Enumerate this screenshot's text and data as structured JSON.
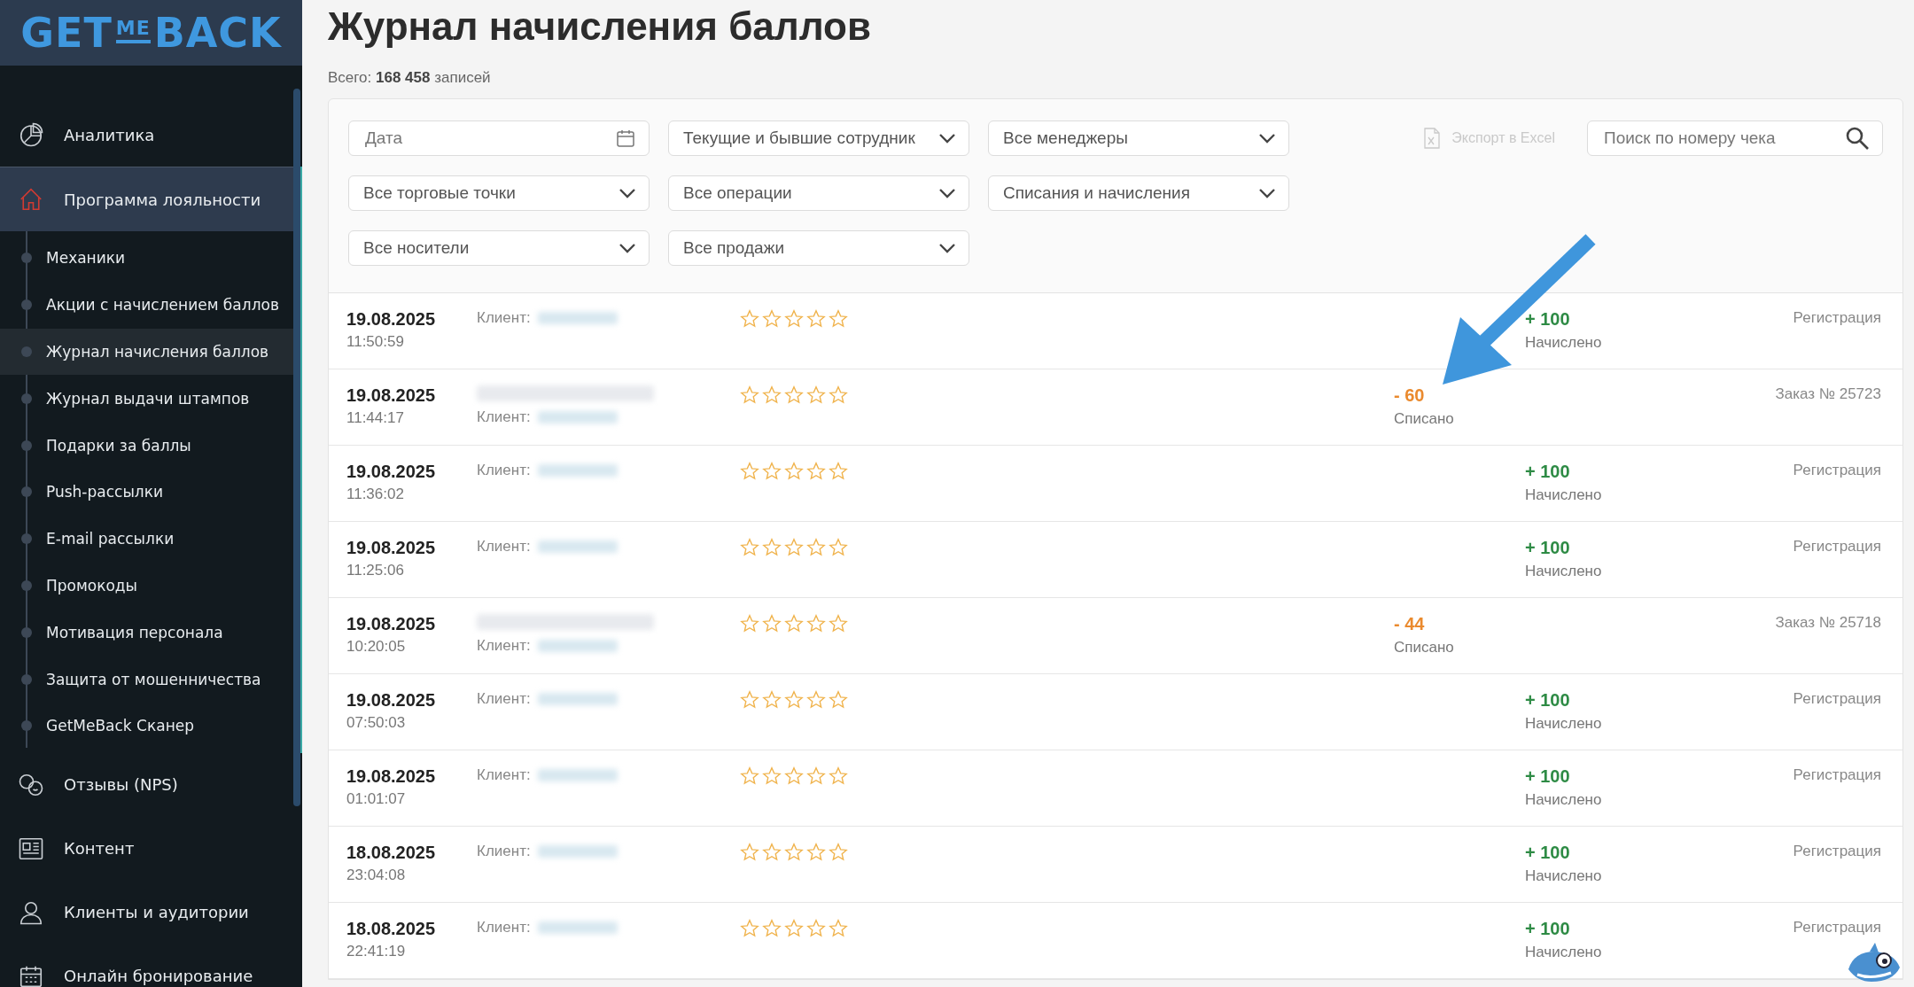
{
  "logo": {
    "parts": [
      "GET",
      "ME",
      "BACK"
    ]
  },
  "sidebar": {
    "items": [
      {
        "kind": "pie",
        "label": "Аналитика",
        "selected": false,
        "expanded": false
      },
      {
        "kind": "house",
        "label": "Программа лояльности",
        "selected": false,
        "expanded": true,
        "children": [
          {
            "label": "Механики",
            "selected": false
          },
          {
            "label": "Акции с начислением баллов",
            "selected": false
          },
          {
            "label": "Журнал начисления баллов",
            "selected": true
          },
          {
            "label": "Журнал выдачи штампов",
            "selected": false
          },
          {
            "label": "Подарки за баллы",
            "selected": false
          },
          {
            "label": "Push-рассылки",
            "selected": false
          },
          {
            "label": "E-mail рассылки",
            "selected": false
          },
          {
            "label": "Промокоды",
            "selected": false
          },
          {
            "label": "Мотивация персонала",
            "selected": false
          },
          {
            "label": "Защита от мошенничества",
            "selected": false
          },
          {
            "label": "GetMeBack Сканер",
            "selected": false
          }
        ]
      },
      {
        "kind": "chat",
        "label": "Отзывы (NPS)",
        "selected": false,
        "expanded": false
      },
      {
        "kind": "news",
        "label": "Контент",
        "selected": false,
        "expanded": false
      },
      {
        "kind": "person",
        "label": "Клиенты и аудитории",
        "selected": false,
        "expanded": false
      },
      {
        "kind": "calendar",
        "label": "Онлайн бронирование",
        "selected": false,
        "expanded": false
      }
    ]
  },
  "page": {
    "title": "Журнал начисления баллов",
    "total": "Всего: **168 458** записей"
  },
  "filters": {
    "rows": [
      [
        {
          "kind": "date",
          "placeholder": "Дата"
        },
        {
          "kind": "select",
          "value": "Текущие и бывшие сотрудник"
        },
        {
          "kind": "select",
          "value": "Все менеджеры"
        }
      ],
      [
        {
          "kind": "select",
          "value": "Все торговые точки"
        },
        {
          "kind": "select",
          "value": "Все операции"
        },
        {
          "kind": "select",
          "value": "Списания и начисления"
        }
      ],
      [
        {
          "kind": "select",
          "value": "Все носители"
        },
        {
          "kind": "select",
          "value": "Все продажи"
        }
      ]
    ],
    "export": {
      "label": "Экспорт в Excel",
      "disabled": true
    },
    "search": {
      "placeholder": "Поиск по номеру чека"
    }
  },
  "records": [
    {
      "date": "19.08.2025",
      "time": "11:50:59",
      "store": false,
      "client_label": "Клиент:",
      "stars": 0,
      "kind": "credit",
      "amount": "+ 100",
      "status": "Начислено",
      "type": "Регистрация"
    },
    {
      "date": "19.08.2025",
      "time": "11:44:17",
      "store": true,
      "client_label": "Клиент:",
      "stars": 0,
      "kind": "debit",
      "amount": "- 60",
      "status": "Списано",
      "type": "Заказ № 25723"
    },
    {
      "date": "19.08.2025",
      "time": "11:36:02",
      "store": false,
      "client_label": "Клиент:",
      "stars": 0,
      "kind": "credit",
      "amount": "+ 100",
      "status": "Начислено",
      "type": "Регистрация"
    },
    {
      "date": "19.08.2025",
      "time": "11:25:06",
      "store": false,
      "client_label": "Клиент:",
      "stars": 0,
      "kind": "credit",
      "amount": "+ 100",
      "status": "Начислено",
      "type": "Регистрация"
    },
    {
      "date": "19.08.2025",
      "time": "10:20:05",
      "store": true,
      "client_label": "Клиент:",
      "stars": 0,
      "kind": "debit",
      "amount": "- 44",
      "status": "Списано",
      "type": "Заказ № 25718"
    },
    {
      "date": "19.08.2025",
      "time": "07:50:03",
      "store": false,
      "client_label": "Клиент:",
      "stars": 0,
      "kind": "credit",
      "amount": "+ 100",
      "status": "Начислено",
      "type": "Регистрация"
    },
    {
      "date": "19.08.2025",
      "time": "01:01:07",
      "store": false,
      "client_label": "Клиент:",
      "stars": 0,
      "kind": "credit",
      "amount": "+ 100",
      "status": "Начислено",
      "type": "Регистрация"
    },
    {
      "date": "18.08.2025",
      "time": "23:04:08",
      "store": false,
      "client_label": "Клиент:",
      "stars": 0,
      "kind": "credit",
      "amount": "+ 100",
      "status": "Начислено",
      "type": "Регистрация"
    },
    {
      "date": "18.08.2025",
      "time": "22:41:19",
      "store": false,
      "client_label": "Клиент:",
      "stars": 0,
      "kind": "credit",
      "amount": "+ 100",
      "status": "Начислено",
      "type": "Регистрация"
    }
  ]
}
